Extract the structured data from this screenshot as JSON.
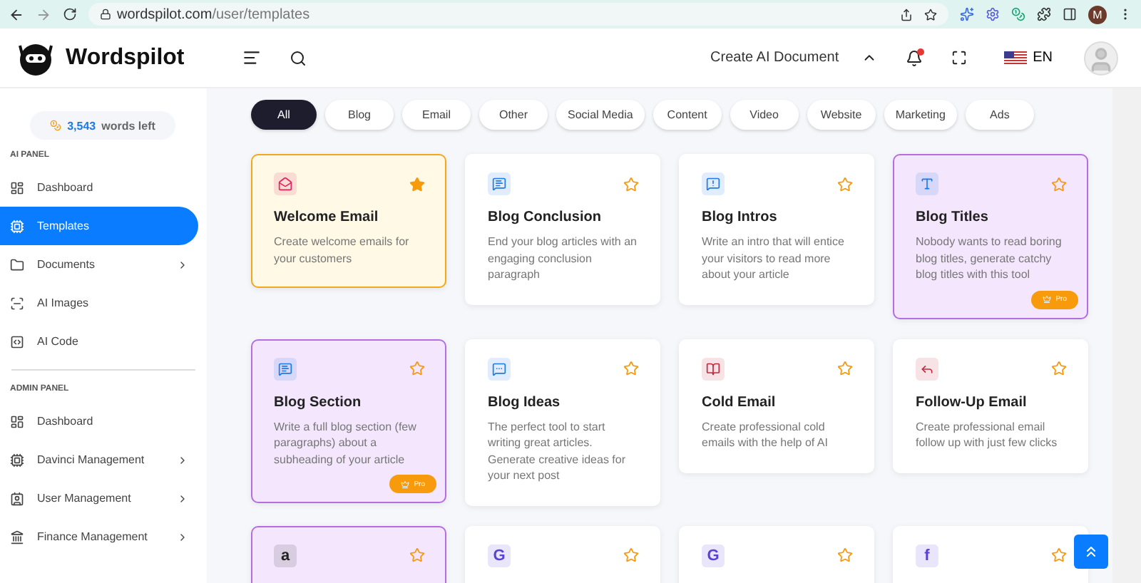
{
  "browser": {
    "url_host": "wordspilot.com",
    "url_path": "/user/templates",
    "profile_initial": "M"
  },
  "header": {
    "brand": "Wordspilot",
    "create_button": "Create AI Document",
    "language": "EN",
    "notification_dot": true
  },
  "sidebar": {
    "credits": {
      "count": "3,543",
      "label": "words left"
    },
    "sections": [
      {
        "title": "AI PANEL",
        "items": [
          {
            "label": "Dashboard",
            "selected": false,
            "submenu": false
          },
          {
            "label": "Templates",
            "selected": true,
            "submenu": false
          },
          {
            "label": "Documents",
            "selected": false,
            "submenu": true
          },
          {
            "label": "AI Images",
            "selected": false,
            "submenu": false
          },
          {
            "label": "AI Code",
            "selected": false,
            "submenu": false
          }
        ]
      },
      {
        "title": "ADMIN PANEL",
        "items": [
          {
            "label": "Dashboard",
            "selected": false,
            "submenu": false
          },
          {
            "label": "Davinci Management",
            "selected": false,
            "submenu": true
          },
          {
            "label": "User Management",
            "selected": false,
            "submenu": true
          },
          {
            "label": "Finance Management",
            "selected": false,
            "submenu": true
          }
        ]
      }
    ]
  },
  "filters": [
    {
      "label": "All",
      "selected": true
    },
    {
      "label": "Blog",
      "selected": false
    },
    {
      "label": "Email",
      "selected": false
    },
    {
      "label": "Other",
      "selected": false
    },
    {
      "label": "Social Media",
      "selected": false
    },
    {
      "label": "Content",
      "selected": false
    },
    {
      "label": "Video",
      "selected": false
    },
    {
      "label": "Website",
      "selected": false
    },
    {
      "label": "Marketing",
      "selected": false
    },
    {
      "label": "Ads",
      "selected": false
    }
  ],
  "cards": [
    {
      "title": "Welcome Email",
      "description": "Create welcome emails for your customers",
      "color": "#e0245e",
      "kind": "featured",
      "favorite": true
    },
    {
      "title": "Blog Conclusion",
      "description": "End your blog articles with an engaging conclusion paragraph",
      "color": "#1e7be6",
      "kind": "standard",
      "favorite": false
    },
    {
      "title": "Blog Intros",
      "description": "Write an intro that will entice your visitors to read more about your article",
      "color": "#1e7be6",
      "kind": "standard",
      "favorite": false
    },
    {
      "title": "Blog Titles",
      "description": "Nobody wants to read boring blog titles, generate catchy blog titles with this tool",
      "color": "#1e7be6",
      "kind": "pro",
      "favorite": false,
      "badge": "Pro"
    },
    {
      "title": "Blog Section",
      "description": "Write a full blog section (few paragraphs) about a subheading of your article",
      "color": "#1e7be6",
      "kind": "pro",
      "favorite": false,
      "badge": "Pro"
    },
    {
      "title": "Blog Ideas",
      "description": "The perfect tool to start writing great articles. Generate creative ideas for your next post",
      "color": "#1e7be6",
      "kind": "standard",
      "favorite": false
    },
    {
      "title": "Cold Email",
      "description": "Create professional cold emails with the help of AI",
      "color": "#c0283e",
      "kind": "standard",
      "favorite": false
    },
    {
      "title": "Follow-Up Email",
      "description": "Create professional email follow up with just few clicks",
      "color": "#c0283e",
      "kind": "standard",
      "favorite": false
    },
    {
      "glyph": "a",
      "color": "#222222",
      "kind": "pro",
      "favorite": false
    },
    {
      "glyph": "G",
      "color": "#5a3fd8",
      "kind": "standard",
      "favorite": false
    },
    {
      "glyph": "G",
      "color": "#5a3fd8",
      "kind": "standard",
      "favorite": false
    },
    {
      "glyph": "f",
      "color": "#5a3fd8",
      "kind": "standard",
      "favorite": false
    }
  ]
}
